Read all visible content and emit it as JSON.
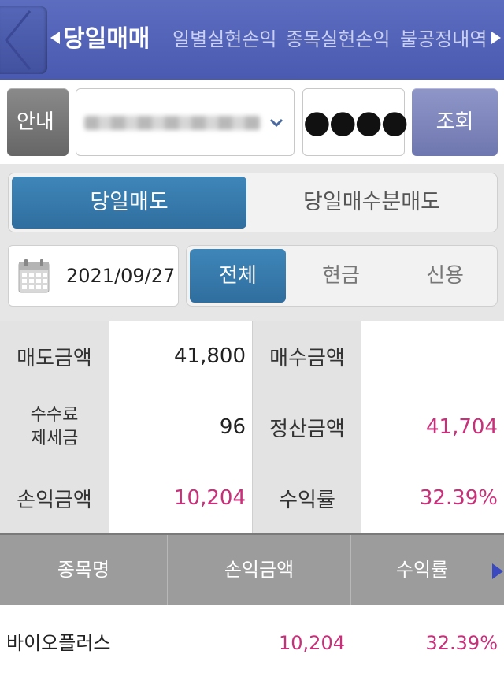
{
  "header": {
    "tabs": [
      {
        "label": "당일매매",
        "active": true
      },
      {
        "label": "일별실현손익",
        "active": false
      },
      {
        "label": "종목실현손익",
        "active": false
      },
      {
        "label": "불공정내역",
        "active": false
      }
    ]
  },
  "account": {
    "info_label": "안내",
    "password_mask": "●●●●",
    "query_label": "조회"
  },
  "trade_type": {
    "options": [
      "당일매도",
      "당일매수분매도"
    ],
    "selected": "당일매도"
  },
  "filter": {
    "date": "2021/09/27",
    "options": [
      "전체",
      "현금",
      "신용"
    ],
    "selected": "전체"
  },
  "summary": {
    "sell_amount_label": "매도금액",
    "sell_amount": "41,800",
    "buy_amount_label": "매수금액",
    "buy_amount": "",
    "fee_label_1": "수수료",
    "fee_label_2": "제세금",
    "fee": "96",
    "settle_label": "정산금액",
    "settle_amount": "41,704",
    "pl_label": "손익금액",
    "pl_amount": "10,204",
    "return_label": "수익률",
    "return_rate": "32.39%"
  },
  "table": {
    "columns": [
      "종목명",
      "손익금액",
      "수익률"
    ],
    "rows": [
      {
        "name": "바이오플러스",
        "pl": "10,204",
        "rate": "32.39%"
      }
    ]
  },
  "colors": {
    "header_bg": "#4f5fb4",
    "active_blue": "#3579ab",
    "profit_pink": "#c8307a",
    "query_btn": "#7d85bd"
  }
}
